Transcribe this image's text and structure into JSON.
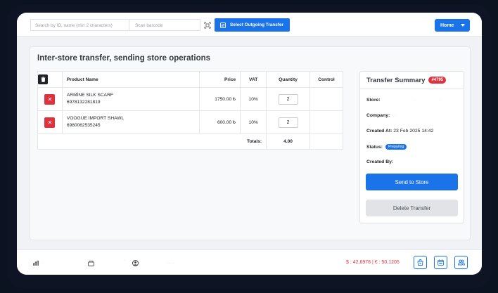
{
  "topbar": {
    "search_placeholder": "Search by ID, name (min 2 characters)",
    "barcode_placeholder": "Scan barcode",
    "select_transfer_label": "Select Outgoing Transfer",
    "home_label": "Home"
  },
  "page": {
    "title": "Inter-store transfer, sending store operations"
  },
  "table": {
    "headers": {
      "product": "Product Name",
      "price": "Price",
      "vat": "VAT",
      "quantity": "Quantity",
      "control": "Control"
    },
    "rows": [
      {
        "name": "ARMİNE SILK SCARF",
        "barcode": "6978132281819",
        "price": "1750.00 ₺",
        "vat": "10%",
        "quantity": "2"
      },
      {
        "name": "VOOGUE IMPORT SHAWL",
        "barcode": "6980062535245",
        "price": "600.00 ₺",
        "vat": "10%",
        "quantity": "2"
      }
    ],
    "totals_label": "Totals:",
    "totals_value": "4.00"
  },
  "summary": {
    "title": "Transfer Summary",
    "id_badge": "#4795",
    "store_label": "Store:",
    "company_label": "Company:",
    "created_at_label": "Created At:",
    "created_at_value": "23 Feb 2025 14:42",
    "status_label": "Status:",
    "status_value": "Preparing",
    "created_by_label": "Created By:",
    "send_label": "Send to Store",
    "delete_label": "Delete Transfer"
  },
  "footer": {
    "currency_text": "$ : 42,6978  |  € : 50,1205"
  },
  "colors": {
    "primary": "#1a73e8",
    "danger": "#e0313e",
    "dark": "#1f2328"
  }
}
